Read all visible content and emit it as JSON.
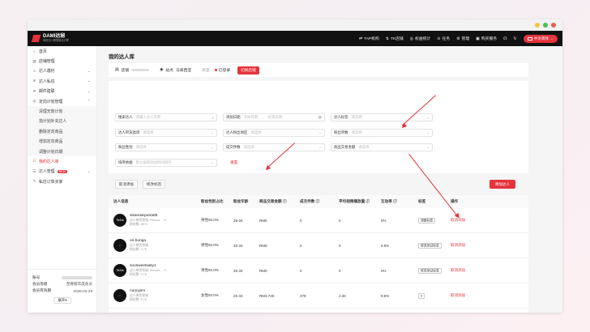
{
  "header": {
    "logo_title": "DAMI达秘",
    "logo_sub": "你的达人跨境增长引擎",
    "nav": [
      {
        "label": "TAP机构",
        "icon": "link-icon"
      },
      {
        "label": "TK店铺",
        "icon": "store-icon"
      },
      {
        "label": "权益统计",
        "icon": "chart-icon"
      },
      {
        "label": "任务",
        "icon": "task-icon"
      },
      {
        "label": "管理",
        "icon": "gear-icon"
      },
      {
        "label": "购买服务",
        "icon": "cart-icon"
      }
    ],
    "lang": "中文简体"
  },
  "sidebar": {
    "items": [
      {
        "label": "首页",
        "icon": "home-icon"
      },
      {
        "label": "店铺管理",
        "icon": "shop-icon"
      },
      {
        "label": "达人邀约",
        "icon": "user-icon",
        "chevron": true
      },
      {
        "label": "达人私信",
        "icon": "message-icon",
        "chevron": true
      },
      {
        "label": "邮件建联",
        "icon": "mail-icon",
        "chevron": true
      },
      {
        "label": "定向计划管理",
        "icon": "target-icon",
        "chevron": true
      }
    ],
    "subitems": [
      "清理无效计划",
      "指计划补充达人",
      "删除定向商品",
      "增加定向商品",
      "调整计划日期"
    ],
    "after": [
      {
        "label": "我的达人库",
        "icon": "people-icon",
        "active": true
      },
      {
        "label": "达人管理",
        "icon": "manage-icon",
        "badge": "NEW",
        "chevron": true
      },
      {
        "label": "私信订单买家",
        "icon": "chat-icon"
      }
    ],
    "account": {
      "account_label": "账号",
      "level_label": "会员等级",
      "level_value": "至尊版年度会员",
      "expiry_label": "会员有效期",
      "expiry_value": "2026-02-28",
      "expand": "展开"
    }
  },
  "main": {
    "title": "我的达人库",
    "store": {
      "shop_label": "店铺",
      "site_label": "站点",
      "site_value": "马来西亚",
      "status_label": "状态",
      "status_value": "已登录",
      "switch_button": "切换店铺"
    },
    "filters": {
      "search_label": "搜索达人",
      "search_ph": "请输入达人名称",
      "date_label": "添加日期",
      "date_start": "开始日期",
      "date_end": "结束日期",
      "tag_label": "达人标签",
      "select_ph": "请选择",
      "cat_label": "达人带货类目",
      "fans_region_label": "达人粉丝地区",
      "fans_count_label": "粉丝单数",
      "gender_label": "粉丝性别",
      "orders_label": "成交件数",
      "sales_label": "商品交易金额",
      "sort_label": "排序依据",
      "sort_ph": "默认按照添加时间排序",
      "reset": "重置",
      "cancel_add": "取消添加",
      "edit_tag": "修改标签",
      "add_creator": "添加达人"
    },
    "table": {
      "headers": [
        "达人信息",
        "粉丝性别占比",
        "粉丝年龄",
        "商品交易金额",
        "成交件数",
        "平均视频播放量",
        "互动率",
        "标签",
        "操作"
      ],
      "rows": [
        {
          "name": "iskandarputra85",
          "sub1": "达人带货领域: Person... +4",
          "sub2": "粉丝数: 6574",
          "gender": "男性50.0%",
          "age": "25-34",
          "gmv": "RM0",
          "orders": "0",
          "views": "0",
          "rate": "0%",
          "tag": "调整标签",
          "op": "取消添加",
          "avatar": "TikTok"
        },
        {
          "name": "on.bunga",
          "sub1": "达人带货领域: -",
          "sub2": "粉丝数: 9.7K",
          "gender": "男性50.0%",
          "age": "25-34",
          "gmv": "RM0",
          "orders": "0",
          "views": "0",
          "rate": "9.9%",
          "tag": "修改测试标签",
          "op": "取消添加",
          "avatar": "♪"
        },
        {
          "name": "soosweetsally1",
          "sub1": "达人带货领域: Person... +4",
          "sub2": "粉丝数: 9.7K",
          "gender": "男性50.0%",
          "age": "25-34",
          "gmv": "RM0",
          "orders": "0",
          "views": "0",
          "rate": "0%",
          "tag": "修改测试标签",
          "op": "取消添加",
          "avatar": "TikTok"
        },
        {
          "name": "nuryyyim",
          "sub1": "达人带货领域: -",
          "sub2": "粉丝数: 9.7K",
          "gender": "女性50.0%",
          "age": "25-34",
          "gmv": "RM4.74K",
          "orders": "378",
          "views": "2.4K",
          "rate": "9.5%",
          "tag": "3",
          "op": "取消添加",
          "avatar": "♪"
        },
        {
          "name": "meiyiin",
          "sub1": "达人带货领域: -",
          "sub2": "",
          "gender": "",
          "age": "",
          "gmv": "",
          "orders": "",
          "views": "",
          "rate": "",
          "tag": "",
          "op": "",
          "avatar": "♪"
        }
      ]
    }
  },
  "colors": {
    "accent": "#e5333b",
    "header_bg": "#111111",
    "traffic_yellow": "#f6c344",
    "traffic_green": "#4cbe57",
    "traffic_red": "#ee5a52"
  }
}
